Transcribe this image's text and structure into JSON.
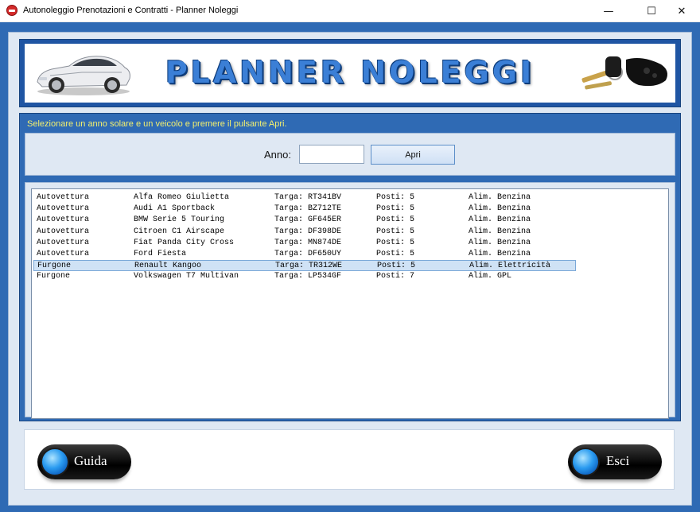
{
  "window": {
    "title": "Autonoleggio Prenotazioni e Contratti - Planner Noleggi",
    "min_glyph": "—",
    "max_glyph": "☐",
    "close_glyph": "✕"
  },
  "banner": {
    "title": "PLANNER NOLEGGI",
    "left_icon": "car-icon",
    "right_icon": "car-keys-icon"
  },
  "form": {
    "instruction": "Selezionare un anno solare e un veicolo e premere il pulsante Apri.",
    "anno_label": "Anno:",
    "anno_value": "",
    "apri_label": "Apri"
  },
  "vehicles": [
    {
      "tipo": "Autovettura",
      "modello": "Alfa Romeo Giulietta",
      "targa": "Targa: RT341BV",
      "posti": "Posti: 5",
      "alim": "Alim. Benzina"
    },
    {
      "tipo": "Autovettura",
      "modello": "Audi A1 Sportback",
      "targa": "Targa: BZ712TE",
      "posti": "Posti: 5",
      "alim": "Alim. Benzina"
    },
    {
      "tipo": "Autovettura",
      "modello": "BMW Serie 5 Touring",
      "targa": "Targa: GF645ER",
      "posti": "Posti: 5",
      "alim": "Alim. Benzina"
    },
    {
      "tipo": "Autovettura",
      "modello": "Citroen C1 Airscape",
      "targa": "Targa: DF398DE",
      "posti": "Posti: 5",
      "alim": "Alim. Benzina"
    },
    {
      "tipo": "Autovettura",
      "modello": "Fiat Panda City Cross",
      "targa": "Targa: MN874DE",
      "posti": "Posti: 5",
      "alim": "Alim. Benzina"
    },
    {
      "tipo": "Autovettura",
      "modello": "Ford Fiesta",
      "targa": "Targa: DF650UY",
      "posti": "Posti: 5",
      "alim": "Alim. Benzina"
    },
    {
      "tipo": "Furgone",
      "modello": "Renault Kangoo",
      "targa": "Targa: TR312WE",
      "posti": "Posti: 5",
      "alim": "Alim. Elettricità"
    },
    {
      "tipo": "Furgone",
      "modello": "Volkswagen T7 Multivan",
      "targa": "Targa: LP534GF",
      "posti": "Posti: 7",
      "alim": "Alim. GPL"
    }
  ],
  "selected_index": 6,
  "buttons": {
    "guida_label": "Guida",
    "esci_label": "Esci"
  },
  "colors": {
    "frame_blue": "#2f6ab4",
    "instruction_yellow": "#f4f06e",
    "selection": "#cfe2f5"
  }
}
